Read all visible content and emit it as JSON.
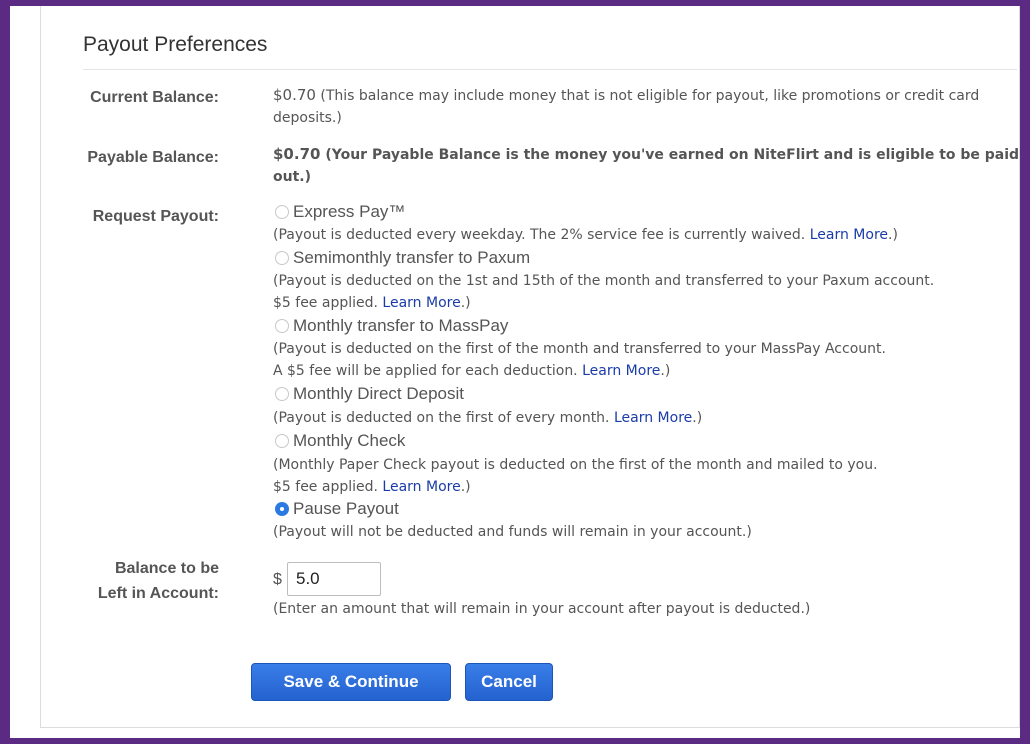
{
  "title": "Payout Preferences",
  "current_balance": {
    "label": "Current Balance:",
    "amount": "$0.70",
    "note": " (This balance may include money that is not eligible for payout, like promotions or credit card deposits.)"
  },
  "payable_balance": {
    "label": "Payable Balance:",
    "amount": "$0.70",
    "note": " (Your Payable Balance is the money you've earned on NiteFlirt and is eligible to be paid out.)"
  },
  "request_payout": {
    "label": "Request Payout:",
    "options": [
      {
        "label": "Express Pay™",
        "desc_lines": [
          "(Payout is deducted every weekday. The 2% service fee is currently waived. "
        ],
        "link": "Learn More",
        "after": ".)",
        "selected": false
      },
      {
        "label": "Semimonthly transfer to Paxum",
        "desc_lines": [
          "(Payout is deducted on the 1st and 15th of the month and transferred to your Paxum account.",
          "$5 fee applied. "
        ],
        "link": "Learn More",
        "after": ".)",
        "selected": false
      },
      {
        "label": "Monthly transfer to MassPay",
        "desc_lines": [
          "(Payout is deducted on the first of the month and transferred to your MassPay Account.",
          "A $5 fee will be applied for each deduction. "
        ],
        "link": "Learn More",
        "after": ".)",
        "selected": false
      },
      {
        "label": "Monthly Direct Deposit",
        "desc_lines": [
          "(Payout is deducted on the first of every month. "
        ],
        "link": "Learn More",
        "after": ".)",
        "selected": false
      },
      {
        "label": "Monthly Check",
        "desc_lines": [
          "(Monthly Paper Check payout is deducted on the first of the month and mailed to you.",
          "$5 fee applied. "
        ],
        "link": "Learn More",
        "after": ".)",
        "selected": false
      },
      {
        "label": "Pause Payout",
        "desc_lines": [
          "(Payout will not be deducted and funds will remain in your account.)"
        ],
        "selected": true
      }
    ]
  },
  "balance_left": {
    "label_line1": "Balance to be",
    "label_line2": "Left in Account:",
    "currency": "$",
    "value": "5.0",
    "hint": "(Enter an amount that will remain in your account after payout is deducted.)"
  },
  "buttons": {
    "save": "Save & Continue",
    "cancel": "Cancel"
  },
  "colors": {
    "frame": "#5b2a82",
    "button": "#2a6ad6",
    "link": "#1a3ca8",
    "radio_selected": "#2a7ae2"
  }
}
